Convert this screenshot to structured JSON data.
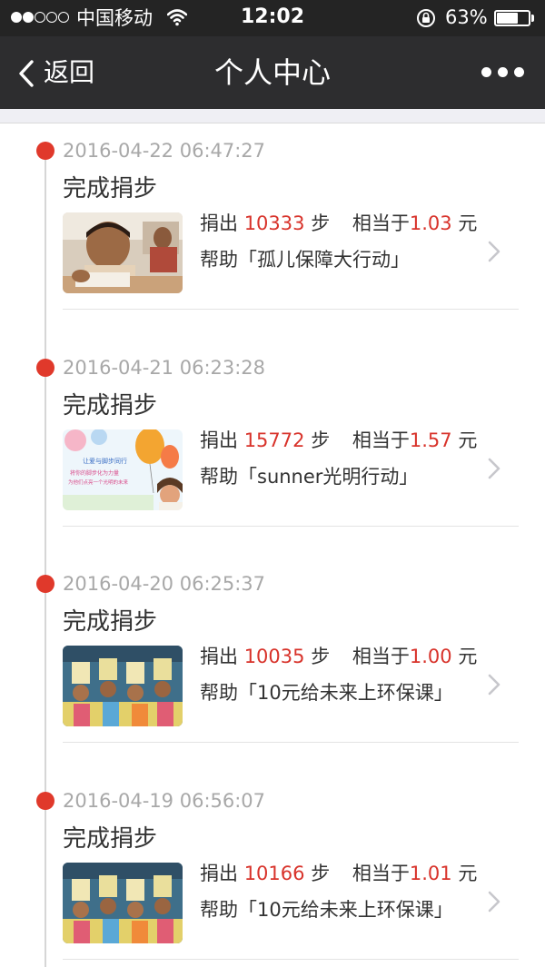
{
  "status_bar": {
    "carrier": "中国移动",
    "signal_bars_filled": 2,
    "signal_bars_total": 5,
    "time": "12:02",
    "battery_percent_label": "63%",
    "battery_level": 0.63
  },
  "nav": {
    "back_label": "返回",
    "title": "个人中心",
    "back_icon": "chevron-left-icon",
    "more_icon": "more-dots-icon"
  },
  "labels": {
    "donate_prefix": "捐出",
    "steps_unit": "步",
    "equals_prefix": "相当于",
    "currency_unit": "元",
    "help_prefix": "帮助"
  },
  "colors": {
    "accent_red": "#e0392b",
    "navbar_bg": "#2d2d2f",
    "statusbar_bg": "#242424"
  },
  "entries": [
    {
      "timestamp": "2016-04-22 06:47:27",
      "title": "完成捐步",
      "steps": "10333",
      "amount": "1.03",
      "project": "「孤儿保障大行动」",
      "thumbnail": "boy-reading-photo"
    },
    {
      "timestamp": "2016-04-21 06:23:28",
      "title": "完成捐步",
      "steps": "15772",
      "amount": "1.57",
      "project": "「sunner光明行动」",
      "thumbnail": "balloons-poster",
      "thumbnail_text": [
        "让爱与脚步同行",
        "将你的脚步化为力量",
        "为他们点亮一个光明的未来"
      ]
    },
    {
      "timestamp": "2016-04-20 06:25:37",
      "title": "完成捐步",
      "steps": "10035",
      "amount": "1.00",
      "project": "「10元给未来上环保课」",
      "thumbnail": "children-group-photo"
    },
    {
      "timestamp": "2016-04-19 06:56:07",
      "title": "完成捐步",
      "steps": "10166",
      "amount": "1.01",
      "project": "「10元给未来上环保课」",
      "thumbnail": "children-group-photo"
    }
  ]
}
